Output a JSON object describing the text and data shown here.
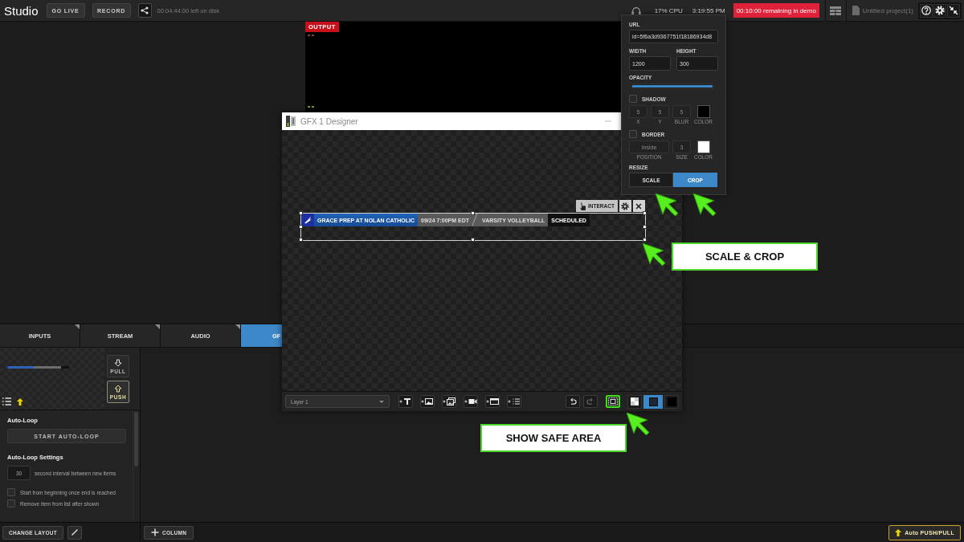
{
  "top_bar": {
    "title": "Studio",
    "go_live": "GO LIVE",
    "record": "RECORD",
    "disk_status": "00:04:44:00 left on disk",
    "cpu": "17% CPU",
    "clock": "3:19:55 PM",
    "demo_notice": "00:10:00 remaining in demo",
    "project_name": "Untitled project(1)"
  },
  "output_preview": {
    "label": "OUTPUT"
  },
  "designer": {
    "title": "GFX 1 Designer",
    "selection_tools": {
      "interact": "INTERACT"
    },
    "banner": [
      {
        "kind": "team",
        "text": "GRACE PREP AT NOLAN CATHOLIC"
      },
      {
        "kind": "time",
        "text": "09/24 7:00PM EDT"
      },
      {
        "kind": "sport",
        "text": "VARSITY VOLLEYBALL"
      },
      {
        "kind": "status",
        "text": "SCHEDULED"
      }
    ],
    "layer_select": "Layer 1",
    "safe_area_button": {
      "highlighted": true
    },
    "backgrounds": [
      {
        "kind": "checker",
        "selected": false
      },
      {
        "kind": "dark",
        "selected": true
      },
      {
        "kind": "black",
        "selected": false
      }
    ]
  },
  "properties_panel": {
    "url": {
      "label": "URL",
      "value": "id=5f6a3d9367751f18186934d8"
    },
    "width": {
      "label": "WIDTH",
      "value": "1200"
    },
    "height": {
      "label": "HEIGHT",
      "value": "300"
    },
    "opacity": {
      "label": "OPACITY",
      "level": 1
    },
    "shadow": {
      "label": "SHADOW",
      "checked": false,
      "fields": [
        {
          "kind": "number",
          "label": "X",
          "value": "5"
        },
        {
          "kind": "number",
          "label": "Y",
          "value": "5"
        },
        {
          "kind": "number",
          "label": "BLUR",
          "value": "5"
        },
        {
          "kind": "color",
          "label": "COLOR",
          "color": "#000000"
        }
      ]
    },
    "border": {
      "label": "BORDER",
      "checked": false,
      "fields": [
        {
          "kind": "text",
          "label": "POSITION",
          "value": "Inside"
        },
        {
          "kind": "number",
          "label": "SIZE",
          "value": "3"
        },
        {
          "kind": "color",
          "label": "COLOR",
          "color": "#ffffff"
        }
      ]
    },
    "resize": {
      "label": "RESIZE",
      "options": [
        {
          "label": "SCALE",
          "selected": false
        },
        {
          "label": "CROP",
          "selected": true
        }
      ]
    }
  },
  "tabs": [
    {
      "label": "INPUTS",
      "selected": false
    },
    {
      "label": "STREAM",
      "selected": false
    },
    {
      "label": "AUDIO",
      "selected": false
    },
    {
      "label": "GF",
      "selected": true
    }
  ],
  "gfx_panel": {
    "transfer_buttons": [
      {
        "label": "PULL",
        "active": false
      },
      {
        "label": "PUSH",
        "active": true
      }
    ],
    "auto_loop": {
      "heading": "Auto-Loop",
      "button": "START AUTO-LOOP"
    },
    "settings": {
      "heading": "Auto-Loop Settings",
      "interval": {
        "value": "30",
        "label": "second interval between new items"
      },
      "options": [
        {
          "label": "Start from beginning once end is reached",
          "checked": false
        },
        {
          "label": "Remove item from list after shown",
          "checked": false
        }
      ]
    }
  },
  "bottom_bar": {
    "change_layout": "CHANGE LAYOUT",
    "add_column": "COLUMN",
    "auto_push_pull": "Auto PUSH/PULL"
  },
  "annotations": {
    "callouts": [
      {
        "text": "SCALE & CROP"
      },
      {
        "text": "SHOW SAFE AREA"
      }
    ]
  }
}
